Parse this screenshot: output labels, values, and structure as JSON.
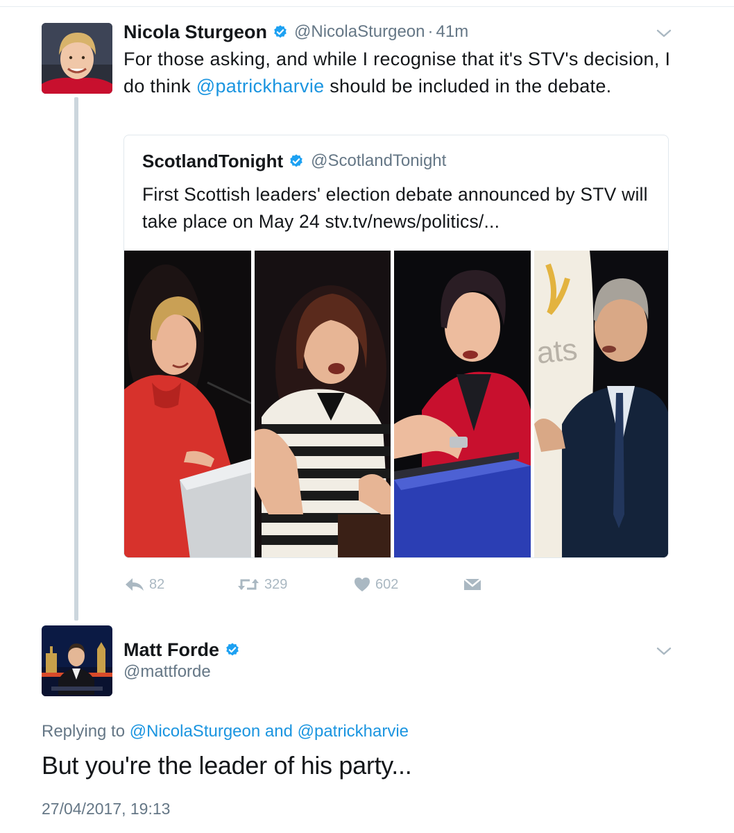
{
  "tweet": {
    "author_name": "Nicola Sturgeon",
    "author_handle": "@NicolaSturgeon",
    "separator": "·",
    "time": "41m",
    "text_parts": {
      "before": "For those asking, and while I recognise that it's STV's decision, I do think ",
      "mention": "@patrickharvie",
      "after": " should be included in the debate."
    },
    "avatar_icon": "avatar-photo-icon",
    "verified_icon": "verified-badge-icon",
    "caret_icon": "chevron-down-icon"
  },
  "quoted_tweet": {
    "author_name": "ScotlandTonight",
    "author_handle": "@ScotlandTonight",
    "text": "First Scottish leaders' election debate announced by STV will take place on May 24 stv.tv/news/politics/...",
    "media_panels": [
      "leader-photo-1",
      "leader-photo-2",
      "leader-photo-3",
      "leader-photo-4"
    ],
    "panel_text": "ats"
  },
  "actions": {
    "reply_count": "82",
    "retweet_count": "329",
    "like_count": "602",
    "icons": [
      "reply-icon",
      "retweet-icon",
      "like-icon",
      "direct-message-icon"
    ]
  },
  "reply": {
    "author_name": "Matt Forde",
    "author_handle": "@mattforde",
    "replying_prefix": "Replying to ",
    "replying_to_1": "@NicolaSturgeon",
    "replying_and": " and ",
    "replying_to_2": "@patrickharvie",
    "text": "But you're the leader of his party...",
    "timestamp": "27/04/2017, 19:13"
  },
  "colors": {
    "link": "#1b95e0",
    "secondary_text": "#657786",
    "action_icons": "#aab8c2",
    "thread_line": "#ccd6dd",
    "verified": "#1da1f2"
  }
}
